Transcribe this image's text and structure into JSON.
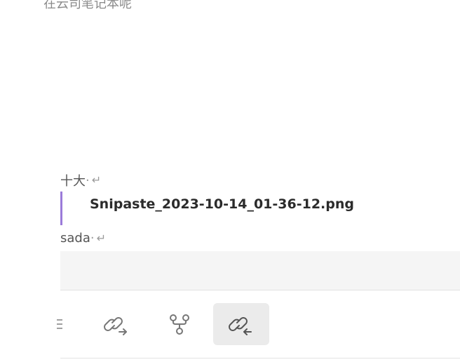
{
  "editor": {
    "top_text": "在云司笔记本呢",
    "para1": {
      "text": "十大",
      "space_mark": "·",
      "return_mark": "↵"
    },
    "attachment": {
      "filename": "Snipaste_2023-10-14_01-36-12.png"
    },
    "para2": {
      "text": "sada",
      "space_mark": "·",
      "return_mark": "↵"
    }
  },
  "toolbar": {
    "items": [
      {
        "icon": "menu-icon",
        "active": false
      },
      {
        "icon": "outgoing-link-icon",
        "active": false
      },
      {
        "icon": "graph-icon",
        "active": false
      },
      {
        "icon": "backlink-icon",
        "active": true
      }
    ]
  },
  "colors": {
    "accent_bar": "#9b7bd9",
    "active_tool_bg": "#ebebeb",
    "strip_bg": "#f5f5f5"
  }
}
